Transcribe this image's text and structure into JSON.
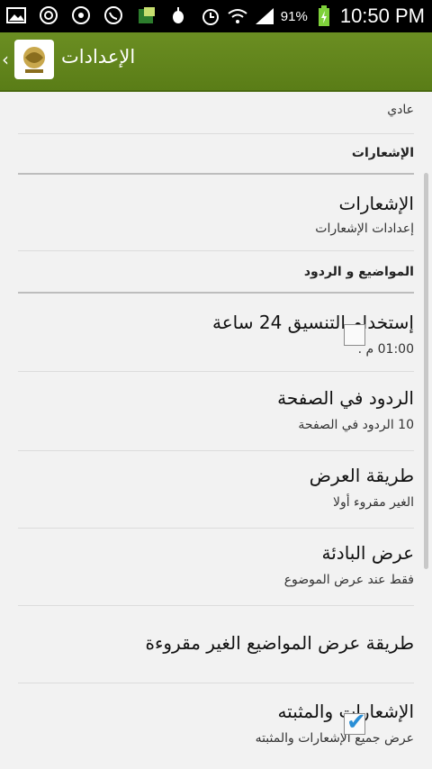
{
  "status_bar": {
    "battery_percent": "91%",
    "time": "10:50 PM",
    "icons": [
      "gallery-icon",
      "sync-icon",
      "download-icon",
      "whatsapp-icon",
      "app-icon",
      "bulb-icon",
      "alarm-icon",
      "wifi-icon",
      "signal-icon",
      "battery-icon"
    ]
  },
  "action_bar": {
    "title": "الإعدادات",
    "back_glyph": "‹"
  },
  "settings": {
    "partial_summary": "عادي",
    "notifications_header": "الإشعارات",
    "notifications_title": "الإشعارات",
    "notifications_summary": "إعدادات الإشعارات",
    "topics_header": "المواضيع و الردود",
    "time24_title": "إستخدام التنسيق 24 ساعة",
    "time24_summary": "01:00 م .",
    "time24_checked": false,
    "replies_title": "الردود في الصفحة",
    "replies_summary": "10 الردود في الصفحة",
    "viewmode_title": "طريقة العرض",
    "viewmode_summary": "الغير مقروء أولا",
    "starter_title": "عرض البادئة",
    "starter_summary": "فقط عند عرض الموضوع",
    "unread_title": "طريقة عرض المواضيع الغير مقروءة",
    "pinned_title": "الإشعارات والمثبته",
    "pinned_summary": "عرض جميع الإشعارات والمثبته",
    "pinned_checked": true
  },
  "colors": {
    "action_bar": "#5f8419",
    "check_accent": "#2a8fd6"
  }
}
